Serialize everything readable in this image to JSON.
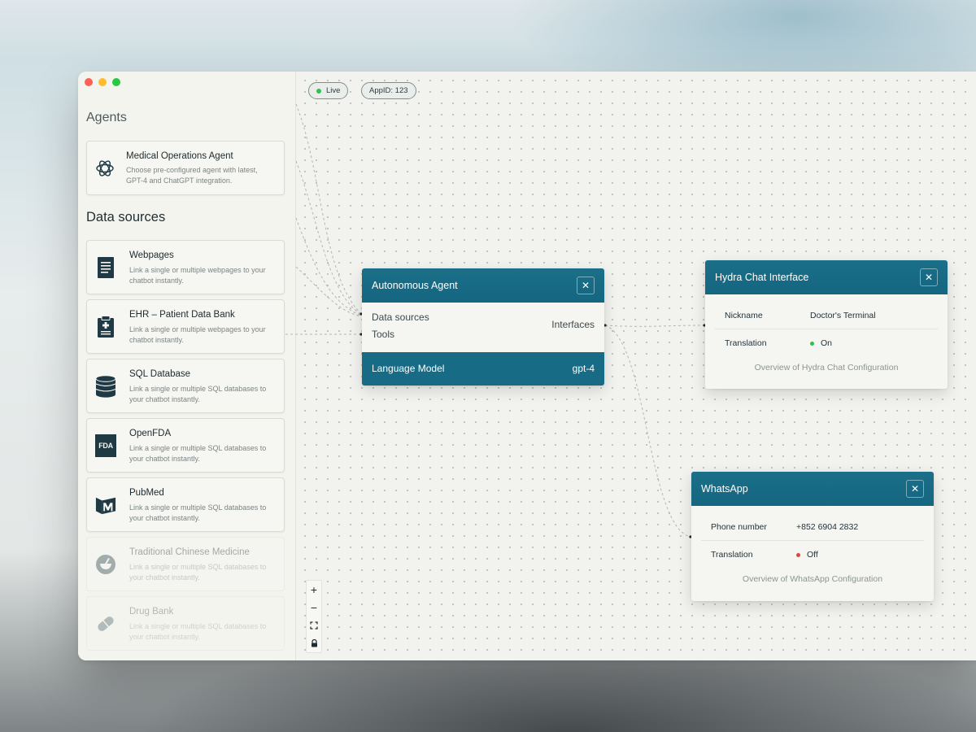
{
  "status": {
    "live_label": "Live",
    "app_id_label": "AppID: 123"
  },
  "sidebar": {
    "agents_title": "Agents",
    "agent_card": {
      "title": "Medical Operations Agent",
      "description": "Choose pre-configured agent with latest, GPT-4 and ChatGPT integration."
    },
    "data_sources_title": "Data sources",
    "sources": [
      {
        "title": "Webpages",
        "description": "Link a single or multiple webpages to your chatbot instantly.",
        "icon": "document-icon"
      },
      {
        "title": "EHR – Patient Data Bank",
        "description": "Link a single or multiple webpages to your chatbot instantly.",
        "icon": "clipboard-medical-icon"
      },
      {
        "title": "SQL Database",
        "description": "Link a single or multiple SQL databases to your chatbot instantly.",
        "icon": "database-icon"
      },
      {
        "title": "OpenFDA",
        "description": "Link a single or multiple SQL databases to your chatbot instantly.",
        "icon": "fda-logo-icon"
      },
      {
        "title": "PubMed",
        "description": "Link a single or multiple SQL databases to your chatbot instantly.",
        "icon": "pubmed-logo-icon"
      },
      {
        "title": "Traditional Chinese Medicine",
        "description": "Link a single or multiple SQL databases to your chatbot instantly.",
        "icon": "mortar-icon"
      },
      {
        "title": "Drug Bank",
        "description": "Link a single or multiple SQL databases to your chatbot instantly.",
        "icon": "pill-icon"
      }
    ],
    "fda_icon_text": "FDA"
  },
  "agent_node": {
    "title": "Autonomous Agent",
    "input_1": "Data sources",
    "input_2": "Tools",
    "output": "Interfaces",
    "model_label": "Language Model",
    "model_value": "gpt-4"
  },
  "hydra_node": {
    "title": "Hydra Chat Interface",
    "nickname_label": "Nickname",
    "nickname_value": "Doctor's Terminal",
    "translation_label": "Translation",
    "translation_value": "On",
    "footer": "Overview of Hydra Chat Configuration",
    "status_color": "#2fbf53"
  },
  "whatsapp_node": {
    "title": "WhatsApp",
    "phone_label": "Phone number",
    "phone_value": "+852 6904 2832",
    "translation_label": "Translation",
    "translation_value": "Off",
    "footer": "Overview of WhatsApp Configuration",
    "status_color": "#e0443e"
  },
  "zoom_controls": {
    "zoom_in": "+",
    "zoom_out": "−"
  },
  "colors": {
    "accent": "#156680",
    "canvas_bg": "#f2f2ef"
  }
}
